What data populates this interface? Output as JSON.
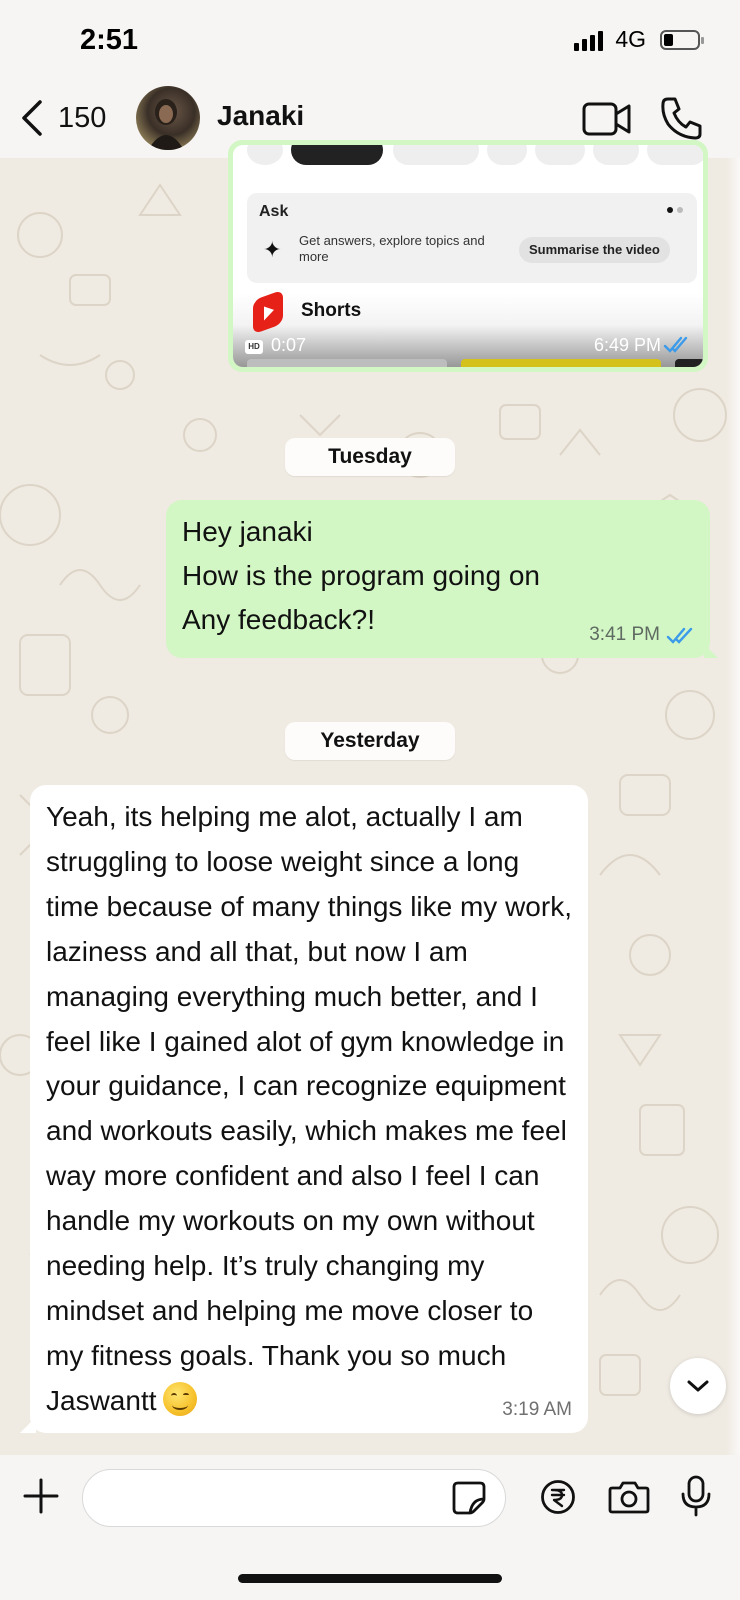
{
  "status_bar": {
    "time": "2:51",
    "network": "4G"
  },
  "header": {
    "back_count": "150",
    "contact_name": "Janaki"
  },
  "media_message": {
    "ask_title": "Ask",
    "ask_description": "Get answers, explore topics and more",
    "summarise_label": "Summarise the video",
    "shorts_label": "Shorts",
    "hd_badge": "HD",
    "duration": "0:07",
    "time": "6:49 PM"
  },
  "date_chips": {
    "first": "Tuesday",
    "second": "Yesterday"
  },
  "outgoing_message": {
    "lines": [
      "Hey janaki",
      "How is the program going on",
      "Any feedback?!"
    ],
    "time": "3:41 PM"
  },
  "incoming_message": {
    "text": "Yeah, its helping me alot, actually I am struggling to loose weight since a long time because of many things like my work, laziness and all that, but now I am managing everything much better, and I feel like I gained alot of gym knowledge in your guidance, I can recognize equipment and workouts easily, which makes me feel way more confident and also I feel I can handle my workouts on my own without needing help. It’s truly changing my mindset and helping me move closer to my fitness goals. Thank you so much Jaswantt",
    "emoji": "smiling-face-emoji",
    "time": "3:19 AM"
  },
  "input_bar": {
    "message_value": "",
    "message_placeholder": ""
  },
  "colors": {
    "outgoing_bubble": "#d2f7c4",
    "incoming_bubble": "#ffffff",
    "chat_background": "#efeae2",
    "read_ticks": "#3b9bea"
  }
}
